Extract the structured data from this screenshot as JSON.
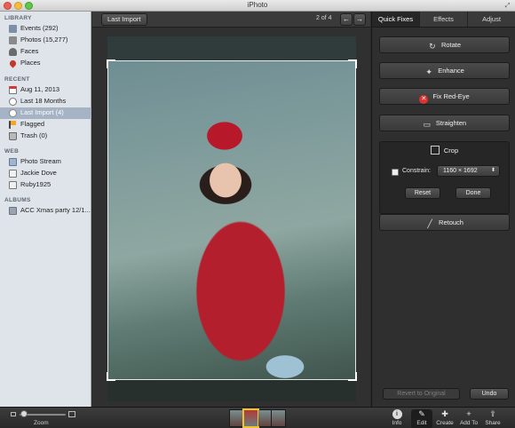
{
  "window": {
    "title": "iPhoto"
  },
  "sidebar": {
    "sections": [
      {
        "heading": "LIBRARY",
        "items": [
          {
            "label": "Events (292)",
            "icon": "events-icon"
          },
          {
            "label": "Photos (15,277)",
            "icon": "photos-icon"
          },
          {
            "label": "Faces",
            "icon": "faces-icon"
          },
          {
            "label": "Places",
            "icon": "places-icon"
          }
        ]
      },
      {
        "heading": "RECENT",
        "items": [
          {
            "label": "Aug 11, 2013",
            "icon": "calendar-icon"
          },
          {
            "label": "Last 18 Months",
            "icon": "clock-icon"
          },
          {
            "label": "Last Import (4)",
            "icon": "last-import-icon",
            "selected": true
          },
          {
            "label": "Flagged",
            "icon": "flag-icon"
          },
          {
            "label": "Trash (0)",
            "icon": "trash-icon"
          }
        ]
      },
      {
        "heading": "WEB",
        "items": [
          {
            "label": "Photo Stream",
            "icon": "photo-stream-icon"
          },
          {
            "label": "Jackie Dove",
            "icon": "web-album-icon"
          },
          {
            "label": "Ruby1925",
            "icon": "web-album-icon"
          }
        ]
      },
      {
        "heading": "ALBUMS",
        "items": [
          {
            "label": "ACC Xmas party 12/1...",
            "icon": "album-icon"
          }
        ]
      }
    ]
  },
  "viewer": {
    "breadcrumb": "Last Import",
    "counter": "2 of 4",
    "prev_glyph": "←",
    "next_glyph": "→"
  },
  "edit_panel": {
    "tabs": [
      {
        "label": "Quick Fixes",
        "active": true
      },
      {
        "label": "Effects",
        "active": false
      },
      {
        "label": "Adjust",
        "active": false
      }
    ],
    "quick_fixes": [
      {
        "label": "Rotate",
        "icon": "rotate-icon",
        "glyph": "↻"
      },
      {
        "label": "Enhance",
        "icon": "enhance-icon",
        "glyph": "✦"
      },
      {
        "label": "Fix Red-Eye",
        "icon": "red-eye-icon",
        "glyph": "✕"
      },
      {
        "label": "Straighten",
        "icon": "straighten-icon",
        "glyph": "▭"
      }
    ],
    "crop": {
      "title": "Crop",
      "constrain_label": "Constrain:",
      "constrain_checked": false,
      "ratio_value": "1160 × 1692",
      "reset_label": "Reset",
      "done_label": "Done"
    },
    "retouch": {
      "label": "Retouch",
      "glyph": "╱"
    },
    "revert_label": "Revert to Original",
    "undo_label": "Undo"
  },
  "bottom_toolbar": {
    "zoom_label": "Zoom",
    "tools": [
      {
        "label": "Info",
        "glyph": "i"
      },
      {
        "label": "Edit",
        "glyph": "✎",
        "active": true
      },
      {
        "label": "Create",
        "glyph": "✚"
      },
      {
        "label": "Add To",
        "glyph": "+"
      },
      {
        "label": "Share",
        "glyph": "⇪"
      }
    ]
  },
  "colors": {
    "accent_selection": "#a6b3c5",
    "panel_dark": "#2f2f2f",
    "red_eye": "#e03030",
    "filmstrip_selected": "#f0c330"
  }
}
